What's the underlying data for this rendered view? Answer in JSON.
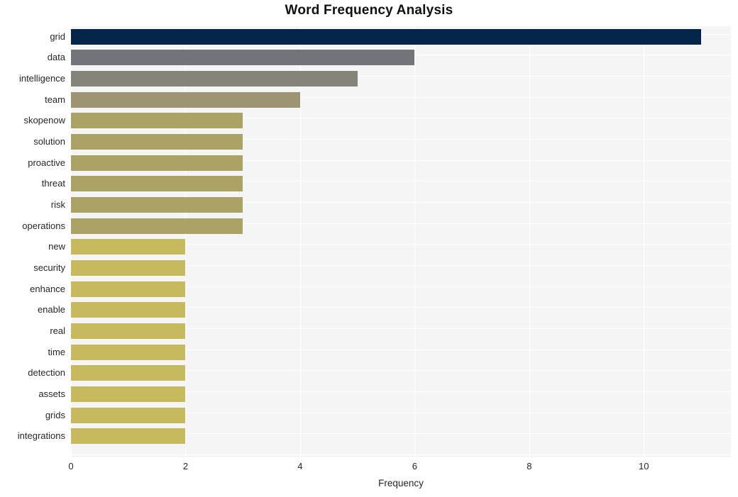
{
  "chart_data": {
    "type": "bar",
    "orientation": "horizontal",
    "title": "Word Frequency Analysis",
    "xlabel": "Frequency",
    "ylabel": "",
    "categories": [
      "grid",
      "data",
      "intelligence",
      "team",
      "skopenow",
      "solution",
      "proactive",
      "threat",
      "risk",
      "operations",
      "new",
      "security",
      "enhance",
      "enable",
      "real",
      "time",
      "detection",
      "assets",
      "grids",
      "integrations"
    ],
    "values": [
      11,
      6,
      5,
      4,
      3,
      3,
      3,
      3,
      3,
      3,
      2,
      2,
      2,
      2,
      2,
      2,
      2,
      2,
      2,
      2
    ],
    "bar_colors": [
      "#042449",
      "#72747a",
      "#84847a",
      "#9c9472",
      "#aba266",
      "#aba266",
      "#aba266",
      "#aba266",
      "#aba266",
      "#aba266",
      "#c7ba5e",
      "#c7ba5e",
      "#c7ba5e",
      "#c7ba5e",
      "#c7ba5e",
      "#c7ba5e",
      "#c7ba5e",
      "#c7ba5e",
      "#c7ba5e",
      "#c7ba5e"
    ],
    "xlim": [
      0,
      11.52
    ],
    "xticks": [
      0,
      2,
      4,
      6,
      8,
      10
    ],
    "xticklabels": [
      "0",
      "2",
      "4",
      "6",
      "8",
      "10"
    ],
    "grid": true,
    "grid_color": "#ffffff",
    "plot_background": "#f5f5f5",
    "figure_background": "#ffffff",
    "legend": null
  },
  "style": {
    "title_color": "#111111",
    "tick_color": "#262626"
  }
}
